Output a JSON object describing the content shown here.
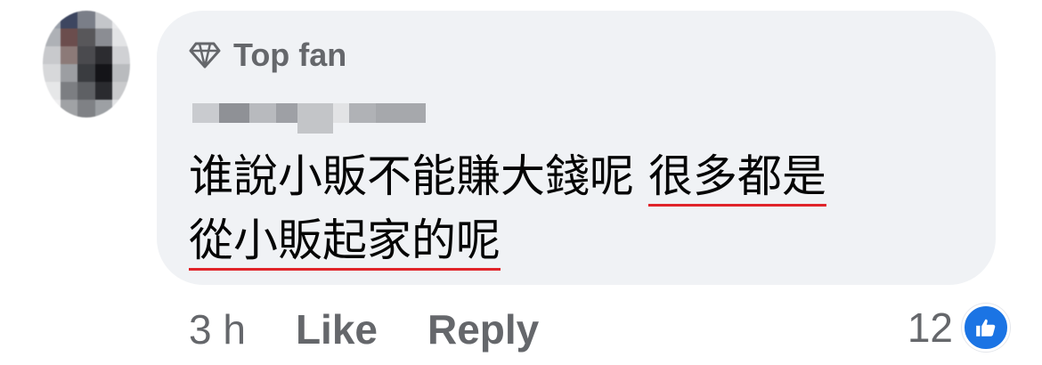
{
  "badge": {
    "label": "Top fan",
    "icon": "diamond-icon"
  },
  "comment": {
    "part1": "谁說小販不能賺大錢呢 ",
    "part2": "很多都是",
    "part3": "從小販起家的呢"
  },
  "actions": {
    "time": "3 h",
    "like": "Like",
    "reply": "Reply"
  },
  "reactions": {
    "count": "12",
    "icon": "thumbs-up-icon",
    "color": "#1b74e4"
  },
  "colors": {
    "bubble": "#f0f2f5",
    "secondary_text": "#65676b",
    "underline": "#e0242a"
  }
}
